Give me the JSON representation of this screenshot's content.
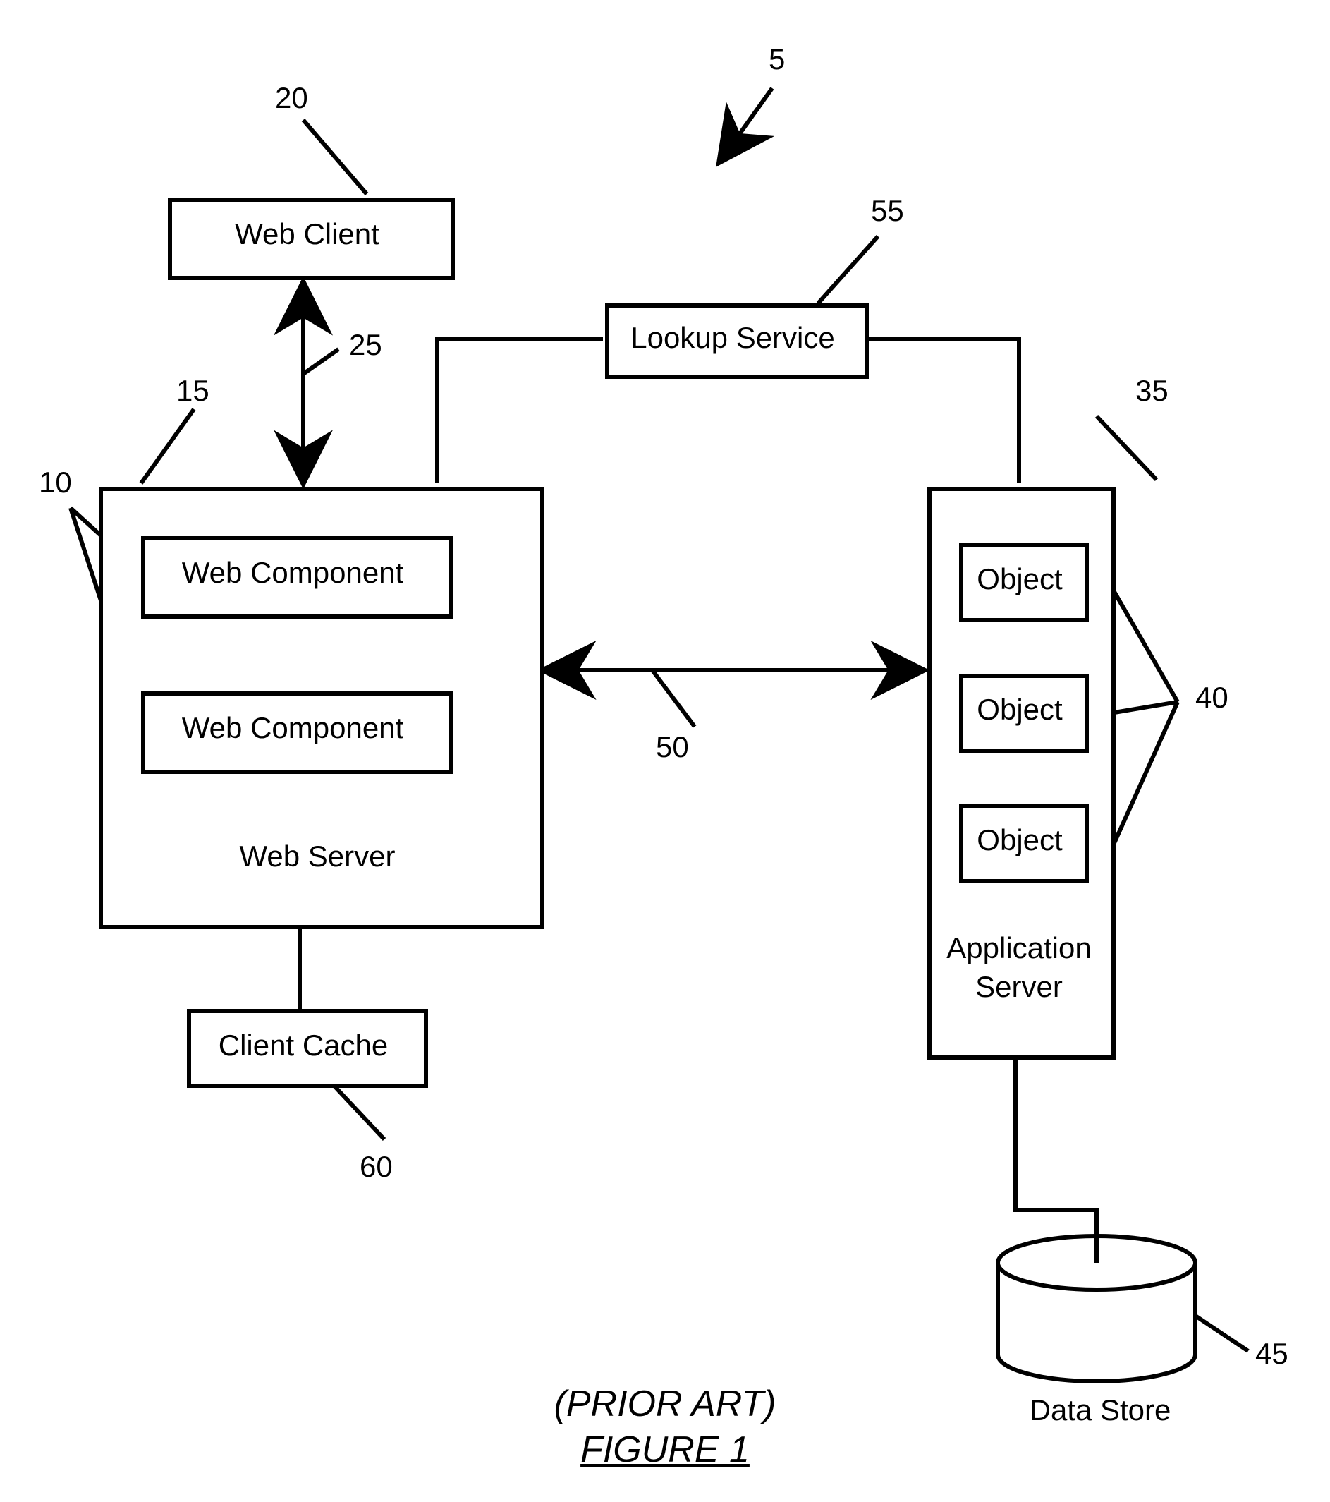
{
  "refs": {
    "system": "5",
    "web_components": "10",
    "web_server": "15",
    "web_client": "20",
    "client_server_link": "25",
    "app_server": "35",
    "objects": "40",
    "data_store": "45",
    "server_link": "50",
    "lookup_service": "55",
    "client_cache": "60"
  },
  "boxes": {
    "web_client": "Web Client",
    "lookup_service": "Lookup Service",
    "web_component": "Web Component",
    "web_server_caption": "Web Server",
    "object": "Object",
    "app_server_caption_l1": "Application",
    "app_server_caption_l2": "Server",
    "client_cache": "Client Cache",
    "data_store": "Data Store"
  },
  "caption": {
    "prior_art": "(PRIOR ART)",
    "figure": "FIGURE 1"
  }
}
